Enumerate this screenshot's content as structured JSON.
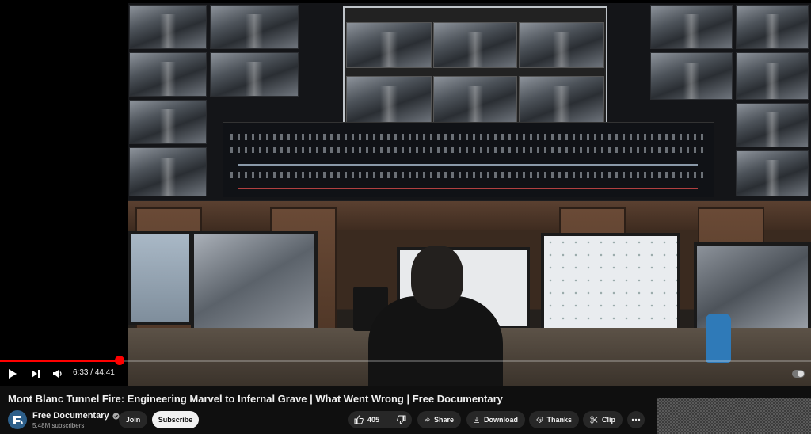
{
  "player": {
    "time_current": "6:33",
    "time_separator": " / ",
    "time_total": "44:41",
    "progress_fraction": 0.147,
    "accent_color": "#ff0000"
  },
  "video": {
    "title": "Mont Blanc Tunnel Fire: Engineering Marvel to Infernal Grave | What Went Wrong | Free Documentary"
  },
  "channel": {
    "name": "Free Documentary",
    "subscribers": "5.48M subscribers",
    "verified_icon": "verified-check-icon"
  },
  "actions": {
    "join_label": "Join",
    "subscribe_label": "Subscribe",
    "like_count": "405",
    "share_label": "Share",
    "download_label": "Download",
    "thanks_label": "Thanks",
    "clip_label": "Clip"
  }
}
